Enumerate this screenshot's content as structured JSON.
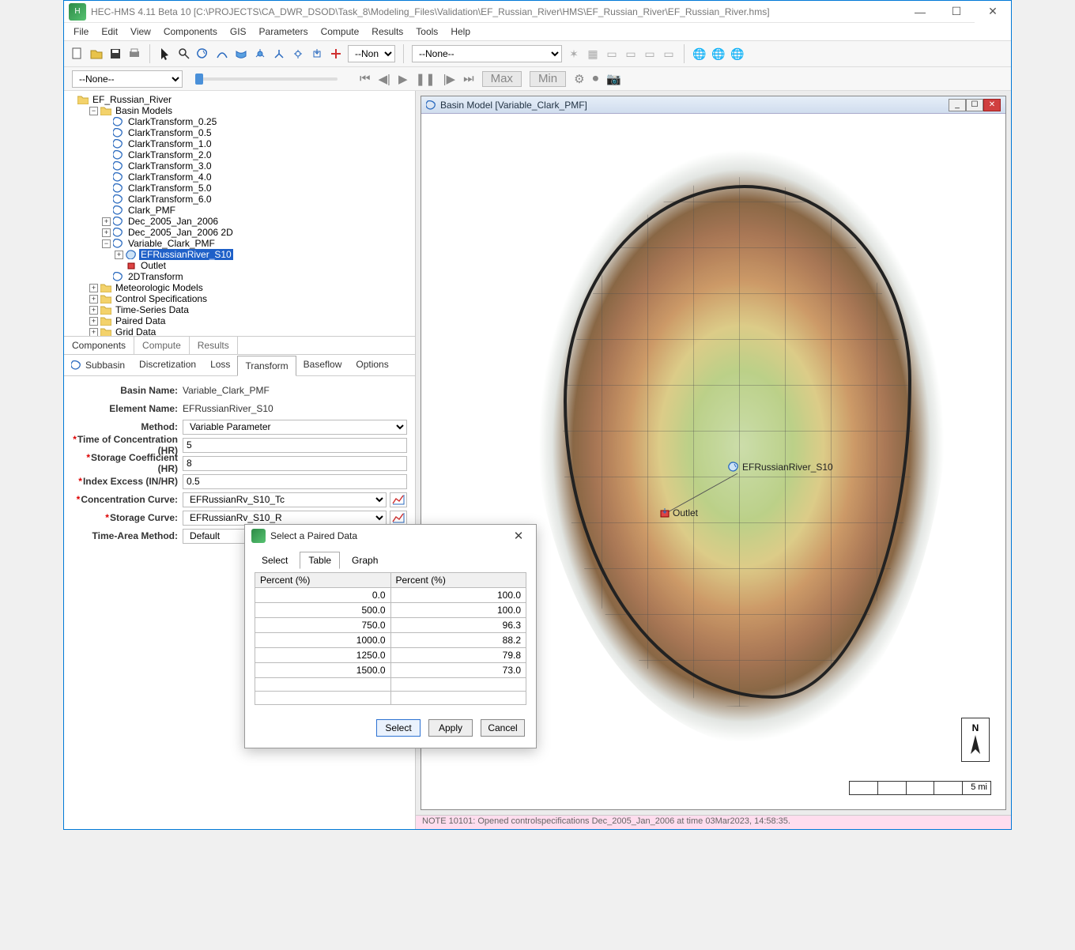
{
  "app": {
    "title": "HEC-HMS 4.11 Beta 10 [C:\\PROJECTS\\CA_DWR_DSOD\\Task_8\\Modeling_Files\\Validation\\EF_Russian_River\\HMS\\EF_Russian_River\\EF_Russian_River.hms]"
  },
  "menu": [
    "File",
    "Edit",
    "View",
    "Components",
    "GIS",
    "Parameters",
    "Compute",
    "Results",
    "Tools",
    "Help"
  ],
  "toolbar": {
    "combo1": "--None--",
    "combo2": "--None--",
    "combo3": "--None--",
    "max": "Max",
    "min": "Min"
  },
  "tree": {
    "root": "EF_Russian_River",
    "basin_models": "Basin Models",
    "items": [
      "ClarkTransform_0.25",
      "ClarkTransform_0.5",
      "ClarkTransform_1.0",
      "ClarkTransform_2.0",
      "ClarkTransform_3.0",
      "ClarkTransform_4.0",
      "ClarkTransform_5.0",
      "ClarkTransform_6.0",
      "Clark_PMF",
      "Dec_2005_Jan_2006",
      "Dec_2005_Jan_2006 2D",
      "Variable_Clark_PMF"
    ],
    "vc_children": {
      "sub": "EFRussianRiver_S10",
      "outlet": "Outlet"
    },
    "tdtransform": "2DTransform",
    "categories": [
      "Meteorologic Models",
      "Control Specifications",
      "Time-Series Data",
      "Paired Data",
      "Grid Data"
    ]
  },
  "lower_tabs": [
    "Components",
    "Compute",
    "Results"
  ],
  "sub_tabs": [
    "Subbasin",
    "Discretization",
    "Loss",
    "Transform",
    "Baseflow",
    "Options"
  ],
  "form": {
    "basin_name_label": "Basin Name:",
    "basin_name": "Variable_Clark_PMF",
    "element_name_label": "Element Name:",
    "element_name": "EFRussianRiver_S10",
    "method_label": "Method:",
    "method": "Variable Parameter",
    "tc_label": "Time of Concentration (HR)",
    "tc": "5",
    "sc_label": "Storage Coefficient (HR)",
    "sc": "8",
    "ie_label": "Index Excess (IN/HR)",
    "ie": "0.5",
    "cc_label": "Concentration Curve:",
    "cc": "EFRussianRv_S10_Tc",
    "scv_label": "Storage Curve:",
    "scv": "EFRussianRv_S10_R",
    "tam_label": "Time-Area Method:",
    "tam": "Default"
  },
  "map": {
    "title": "Basin Model [Variable_Clark_PMF]",
    "node_sub": "EFRussianRiver_S10",
    "node_outlet": "Outlet",
    "north": "N",
    "scale": "5 mi"
  },
  "dialog": {
    "title": "Select a Paired Data",
    "tabs": [
      "Select",
      "Table",
      "Graph"
    ],
    "col1": "Percent (%)",
    "col2": "Percent (%)",
    "rows": [
      [
        "0.0",
        "100.0"
      ],
      [
        "500.0",
        "100.0"
      ],
      [
        "750.0",
        "96.3"
      ],
      [
        "1000.0",
        "88.2"
      ],
      [
        "1250.0",
        "79.8"
      ],
      [
        "1500.0",
        "73.0"
      ]
    ],
    "btn_select": "Select",
    "btn_apply": "Apply",
    "btn_cancel": "Cancel"
  },
  "status": "NOTE 10101:  Opened controlspecifications  Dec_2005_Jan_2006  at time 03Mar2023, 14:58:35.",
  "chart_data": {
    "type": "table",
    "columns": [
      "Percent (%)",
      "Percent (%)"
    ],
    "rows": [
      [
        0.0,
        100.0
      ],
      [
        500.0,
        100.0
      ],
      [
        750.0,
        96.3
      ],
      [
        1000.0,
        88.2
      ],
      [
        1250.0,
        79.8
      ],
      [
        1500.0,
        73.0
      ]
    ]
  }
}
